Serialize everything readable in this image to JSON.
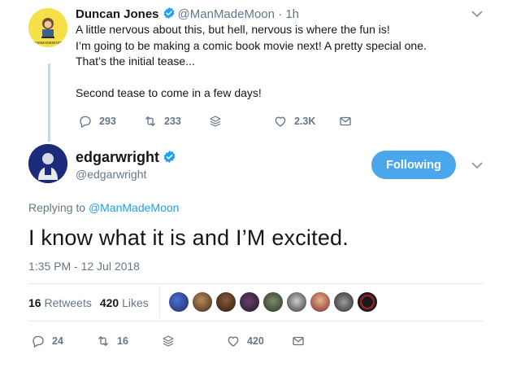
{
  "parent": {
    "name": "Duncan Jones",
    "handle": "@ManMadeMoon",
    "time": "1h",
    "text": "A little nervous about this, but hell, nervous is where the fun is!\nI’m going to be making a comic book movie next!  A pretty special one.\nThat’s the initial tease...\n\nSecond tease to come in a few days!",
    "avatar_label": "MANMADEMOON",
    "replies": "293",
    "retweets": "233",
    "likes": "2.3K"
  },
  "main": {
    "name": "edgarwright",
    "handle": "@edgarwright",
    "follow_label": "Following",
    "replying_prefix": "Replying to ",
    "replying_handle": "@ManMadeMoon",
    "text": "I know what it is and I’M excited.",
    "timestamp": "1:35 PM - 12 Jul 2018",
    "retweet_count": "16",
    "retweet_label": "Retweets",
    "like_count": "420",
    "like_label": "Likes",
    "action_replies": "24",
    "action_retweets": "16",
    "action_likes": "420"
  },
  "colors": {
    "accent": "#1da1f2",
    "follow_button": "#4aa7ec",
    "muted": "#657786",
    "thread_line": "#b7dcf5"
  },
  "icons": [
    "verified-badge-icon",
    "chevron-down-icon",
    "reply-icon",
    "retweet-icon",
    "stack-icon",
    "heart-icon",
    "envelope-icon"
  ]
}
